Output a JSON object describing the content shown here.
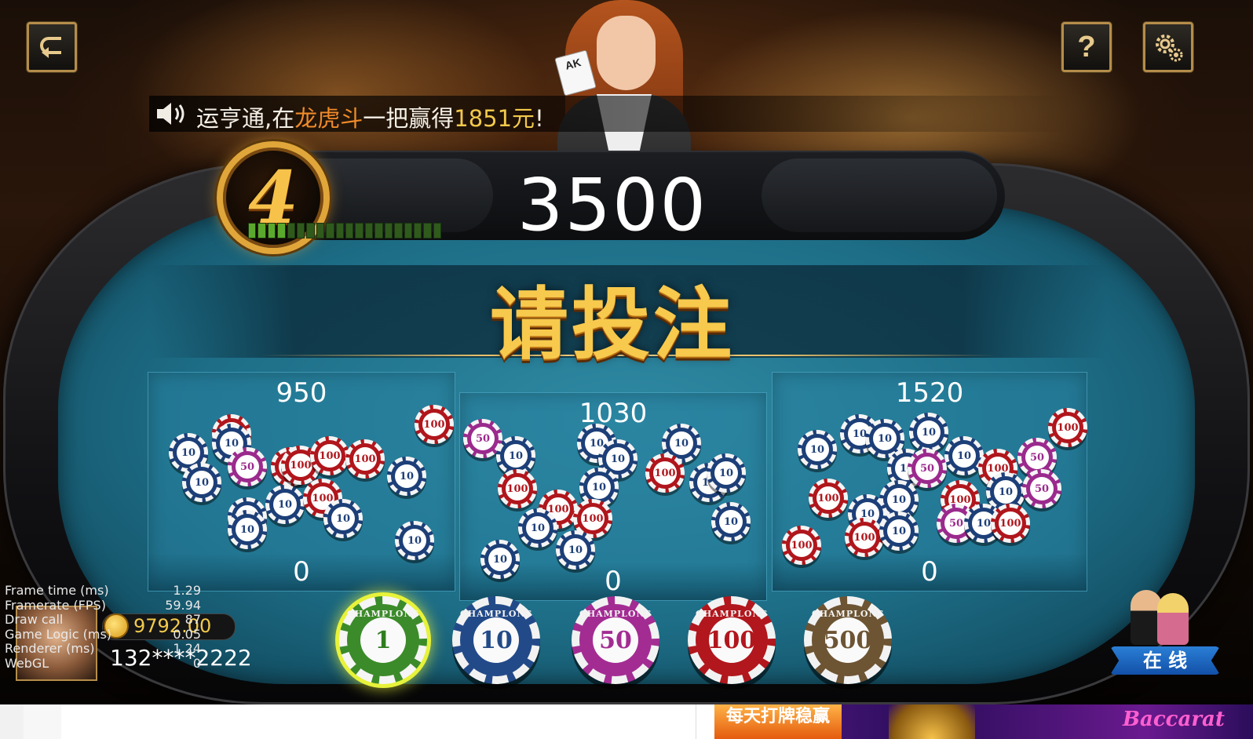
{
  "header": {
    "back_icon": "back-arrow-icon",
    "help_label": "?",
    "settings_icon": "gear-icon"
  },
  "marquee": {
    "icon": "speaker-icon",
    "prefix": "运亨通,在",
    "game": "龙虎斗",
    "middle": "一把赢得",
    "amount": "1851元",
    "suffix": "!"
  },
  "round": {
    "number": "4",
    "countdown_fraction": 0.2
  },
  "pot_total": "3500",
  "prompt": "请投注",
  "bet_areas": [
    {
      "total": "950",
      "mine": "0"
    },
    {
      "total": "1030",
      "mine": "0"
    },
    {
      "total": "1520",
      "mine": "0"
    }
  ],
  "chip_selector": [
    {
      "value": "1",
      "brand": "CHAMPLONS",
      "selected": true
    },
    {
      "value": "10",
      "brand": "CHAMPLONS",
      "selected": false
    },
    {
      "value": "50",
      "brand": "CHAMPLONS",
      "selected": false
    },
    {
      "value": "100",
      "brand": "CHAMPLONS",
      "selected": false
    },
    {
      "value": "500",
      "brand": "CHAMPLONS",
      "selected": false
    }
  ],
  "player": {
    "coins": "9792.00",
    "id": "132****2222"
  },
  "debug_overlay": [
    {
      "label": "Frame time (ms)",
      "value": "1.29"
    },
    {
      "label": "Framerate (FPS)",
      "value": "59.94"
    },
    {
      "label": "Draw call",
      "value": "87"
    },
    {
      "label": "Game Logic (ms)",
      "value": "0.05"
    },
    {
      "label": "Renderer (ms)",
      "value": "1.24"
    },
    {
      "label": "WebGL",
      "value": "0"
    }
  ],
  "online": {
    "label": "在 线"
  },
  "ad_banner": {
    "headline": "每天打牌稳赢",
    "brand": "Baccarat"
  },
  "colors": {
    "gold": "#f7c94d",
    "felt": "#1d6d86",
    "marquee_game": "#f08a2a",
    "marquee_amount": "#f2c94c"
  }
}
